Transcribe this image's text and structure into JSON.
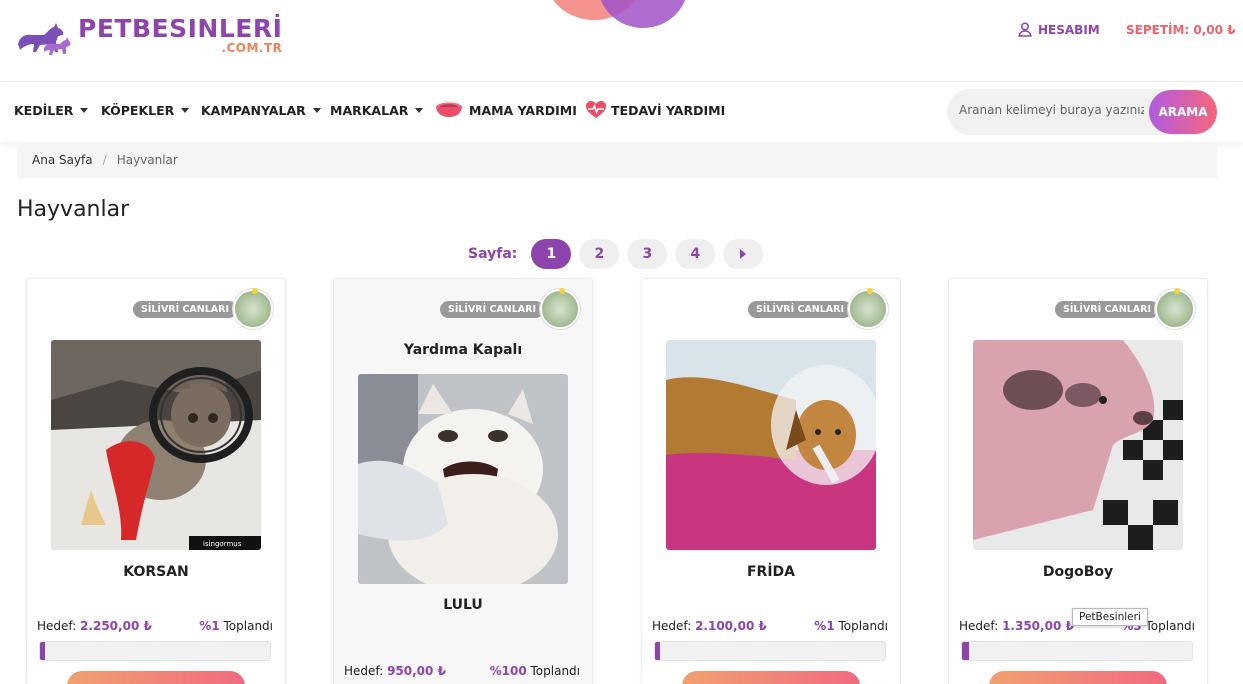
{
  "header": {
    "logo_main": "PETBESINLERİ",
    "logo_sub": ".COM.TR",
    "account_label": "HESABIM",
    "cart_label": "SEPETİM: 0,00 ₺"
  },
  "nav": {
    "items": [
      {
        "label": "KEDİLER",
        "dropdown": true
      },
      {
        "label": "KÖPEKLER",
        "dropdown": true
      },
      {
        "label": "KAMPANYALAR",
        "dropdown": true
      },
      {
        "label": "MARKALAR",
        "dropdown": true
      },
      {
        "label": "MAMA YARDIMI",
        "icon": "food-bowl-icon"
      },
      {
        "label": "TEDAVİ YARDIMI",
        "icon": "heart-pulse-icon"
      }
    ],
    "search_placeholder": "Aranan kelimeyi buraya yazınız..",
    "search_button": "ARAMA"
  },
  "breadcrumb": {
    "home": "Ana Sayfa",
    "separator": "/",
    "current": "Hayvanlar"
  },
  "page_title": "Hayvanlar",
  "pagination": {
    "label": "Sayfa:",
    "pages": [
      "1",
      "2",
      "3",
      "4"
    ],
    "active": "1"
  },
  "cards": [
    {
      "organization": "SİLİVRİ CANLARI",
      "name": "KORSAN",
      "closed_label": "",
      "goal_label": "Hedef:",
      "goal_amount": "2.250,00 ₺",
      "percent": "%1",
      "collected_label": "Toplandı",
      "progress": 0.01,
      "watermark": "isingormus"
    },
    {
      "organization": "SİLİVRİ CANLARI",
      "name": "LULU",
      "closed_label": "Yardıma Kapalı",
      "goal_label": "Hedef:",
      "goal_amount": "950,00 ₺",
      "percent": "%100",
      "collected_label": "Toplandı",
      "progress": 1.0
    },
    {
      "organization": "SİLİVRİ CANLARI",
      "name": "FRİDA",
      "closed_label": "",
      "goal_label": "Hedef:",
      "goal_amount": "2.100,00 ₺",
      "percent": "%1",
      "collected_label": "Toplandı",
      "progress": 0.01
    },
    {
      "organization": "SİLİVRİ CANLARI",
      "name": "DogoBoy",
      "closed_label": "",
      "goal_label": "Hedef:",
      "goal_amount": "1.350,00 ₺",
      "percent": "%3",
      "collected_label": "Toplandı",
      "progress": 0.03
    }
  ],
  "tooltip": "PetBesinleri",
  "colors": {
    "brand_purple": "#8e44ad",
    "brand_orange": "#f0825a",
    "cart_red": "#f0606a"
  }
}
